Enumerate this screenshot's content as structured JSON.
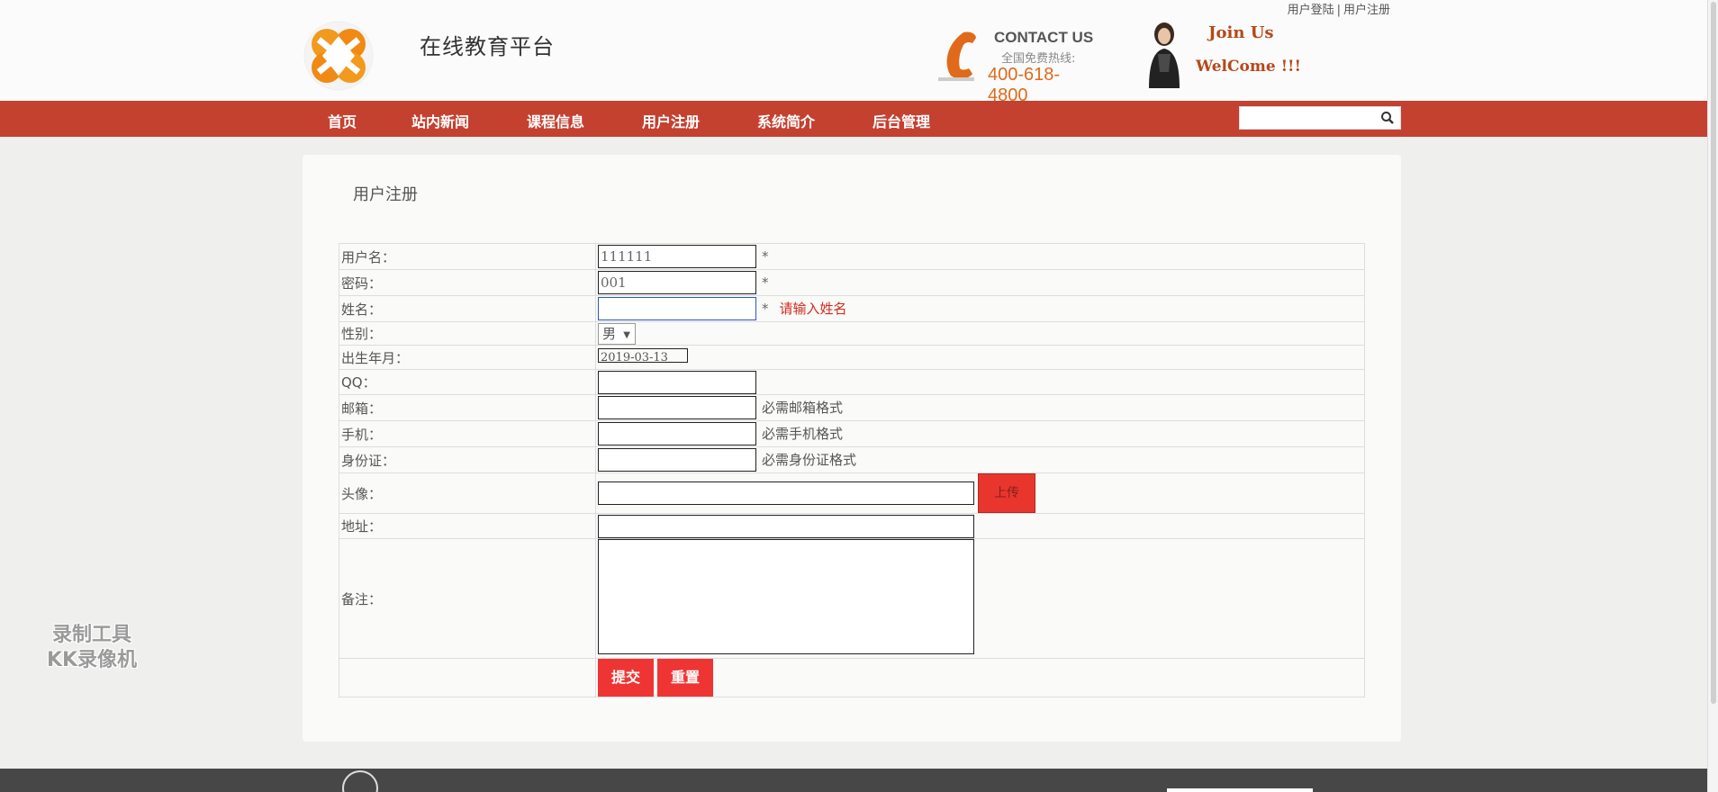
{
  "header": {
    "top_links": {
      "login": "用户登陆",
      "separator": "|",
      "register": "用户注册"
    },
    "site_title": "在线教育平台",
    "contact_label": "CONTACT US",
    "hotline_label": "全国免费热线:",
    "hotline": "400-618-4800",
    "join_text": "Join Us",
    "welcome_text": "WelCome !!!"
  },
  "nav": {
    "items": [
      {
        "label": "首页"
      },
      {
        "label": "站内新闻"
      },
      {
        "label": "课程信息"
      },
      {
        "label": "用户注册"
      },
      {
        "label": "系统简介"
      },
      {
        "label": "后台管理"
      }
    ],
    "search_value": ""
  },
  "form": {
    "title": "用户注册",
    "username_label": "用户名：",
    "username_value": "111111",
    "username_required": "*",
    "password_label": "密码：",
    "password_value": "001",
    "password_required": "*",
    "name_label": "姓名：",
    "name_value": "",
    "name_required": "*",
    "name_error": "请输入姓名",
    "gender_label": "性别：",
    "gender_value": "男",
    "birth_label": "出生年月：",
    "birth_value": "2019-03-13",
    "qq_label": "QQ：",
    "email_label": "邮箱：",
    "email_hint": "必需邮箱格式",
    "phone_label": "手机：",
    "phone_hint": "必需手机格式",
    "idcard_label": "身份证：",
    "idcard_hint": "必需身份证格式",
    "avatar_label": "头像：",
    "upload_label": "上传",
    "address_label": "地址：",
    "notes_label": "备注：",
    "submit_label": "提交",
    "reset_label": "重置"
  },
  "watermark": {
    "line1": "录制工具",
    "line2": "KK录像机"
  },
  "colors": {
    "nav_bg": "#c44130",
    "button_red": "#ef3534",
    "hotline_orange": "#e06a1a",
    "error_red": "#d02a1e"
  },
  "icons": [
    "logo-icon",
    "phone-icon",
    "avatar-image",
    "search-icon"
  ]
}
